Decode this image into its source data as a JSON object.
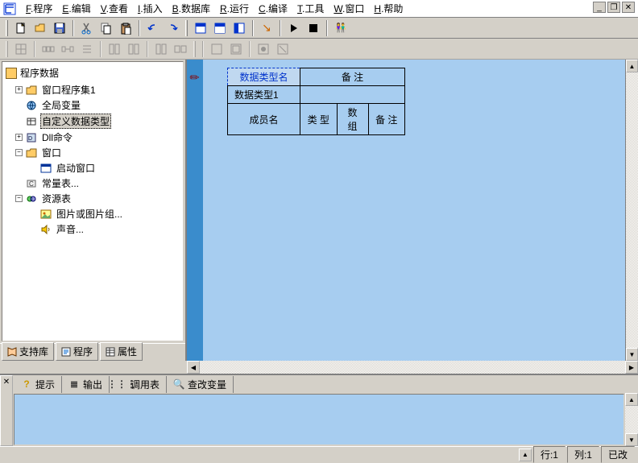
{
  "menu": {
    "items": [
      {
        "u": "F",
        "t": ".程序"
      },
      {
        "u": "E",
        "t": ".编辑"
      },
      {
        "u": "V",
        "t": ".查看"
      },
      {
        "u": "I",
        "t": ".插入"
      },
      {
        "u": "B",
        "t": ".数据库"
      },
      {
        "u": "R",
        "t": ".运行"
      },
      {
        "u": "C",
        "t": ".编译"
      },
      {
        "u": "T",
        "t": ".工具"
      },
      {
        "u": "W",
        "t": ".窗口"
      },
      {
        "u": "H",
        "t": ".帮助"
      }
    ]
  },
  "tree": {
    "title": "程序数据",
    "nodes": [
      {
        "depth": 0,
        "exp": "+",
        "icon": "folder",
        "label": "窗口程序集1"
      },
      {
        "depth": 0,
        "exp": "",
        "icon": "globe",
        "label": "全局变量"
      },
      {
        "depth": 0,
        "exp": "",
        "icon": "data",
        "label": "自定义数据类型",
        "selected": true
      },
      {
        "depth": 0,
        "exp": "+",
        "icon": "dll",
        "label": "Dll命令"
      },
      {
        "depth": 0,
        "exp": "-",
        "icon": "folder",
        "label": "窗口"
      },
      {
        "depth": 1,
        "exp": "",
        "icon": "win",
        "label": "启动窗口"
      },
      {
        "depth": 0,
        "exp": "",
        "icon": "const",
        "label": "常量表..."
      },
      {
        "depth": 0,
        "exp": "-",
        "icon": "res",
        "label": "资源表"
      },
      {
        "depth": 1,
        "exp": "",
        "icon": "img",
        "label": "图片或图片组..."
      },
      {
        "depth": 1,
        "exp": "",
        "icon": "snd",
        "label": "声音..."
      }
    ]
  },
  "lefttabs": [
    {
      "icon": "book",
      "label": "支持库"
    },
    {
      "icon": "prog",
      "label": "程序"
    },
    {
      "icon": "prop",
      "label": "属性"
    }
  ],
  "datatable": {
    "r1": [
      "数据类型名",
      "备 注"
    ],
    "r2": "数据类型1",
    "r3": [
      "成员名",
      "类 型",
      "数组",
      "备 注"
    ]
  },
  "btabs": [
    {
      "icon": "?",
      "color": "#cc9900",
      "label": "提示"
    },
    {
      "icon": "≣",
      "color": "#333",
      "label": "输出"
    },
    {
      "icon": "⋮⋮⋮",
      "color": "#333",
      "label": "调用表"
    },
    {
      "icon": "🔍",
      "color": "#333",
      "label": "查改变量"
    }
  ],
  "status": {
    "row": "行:1",
    "col": "列:1",
    "mod": "已改"
  }
}
